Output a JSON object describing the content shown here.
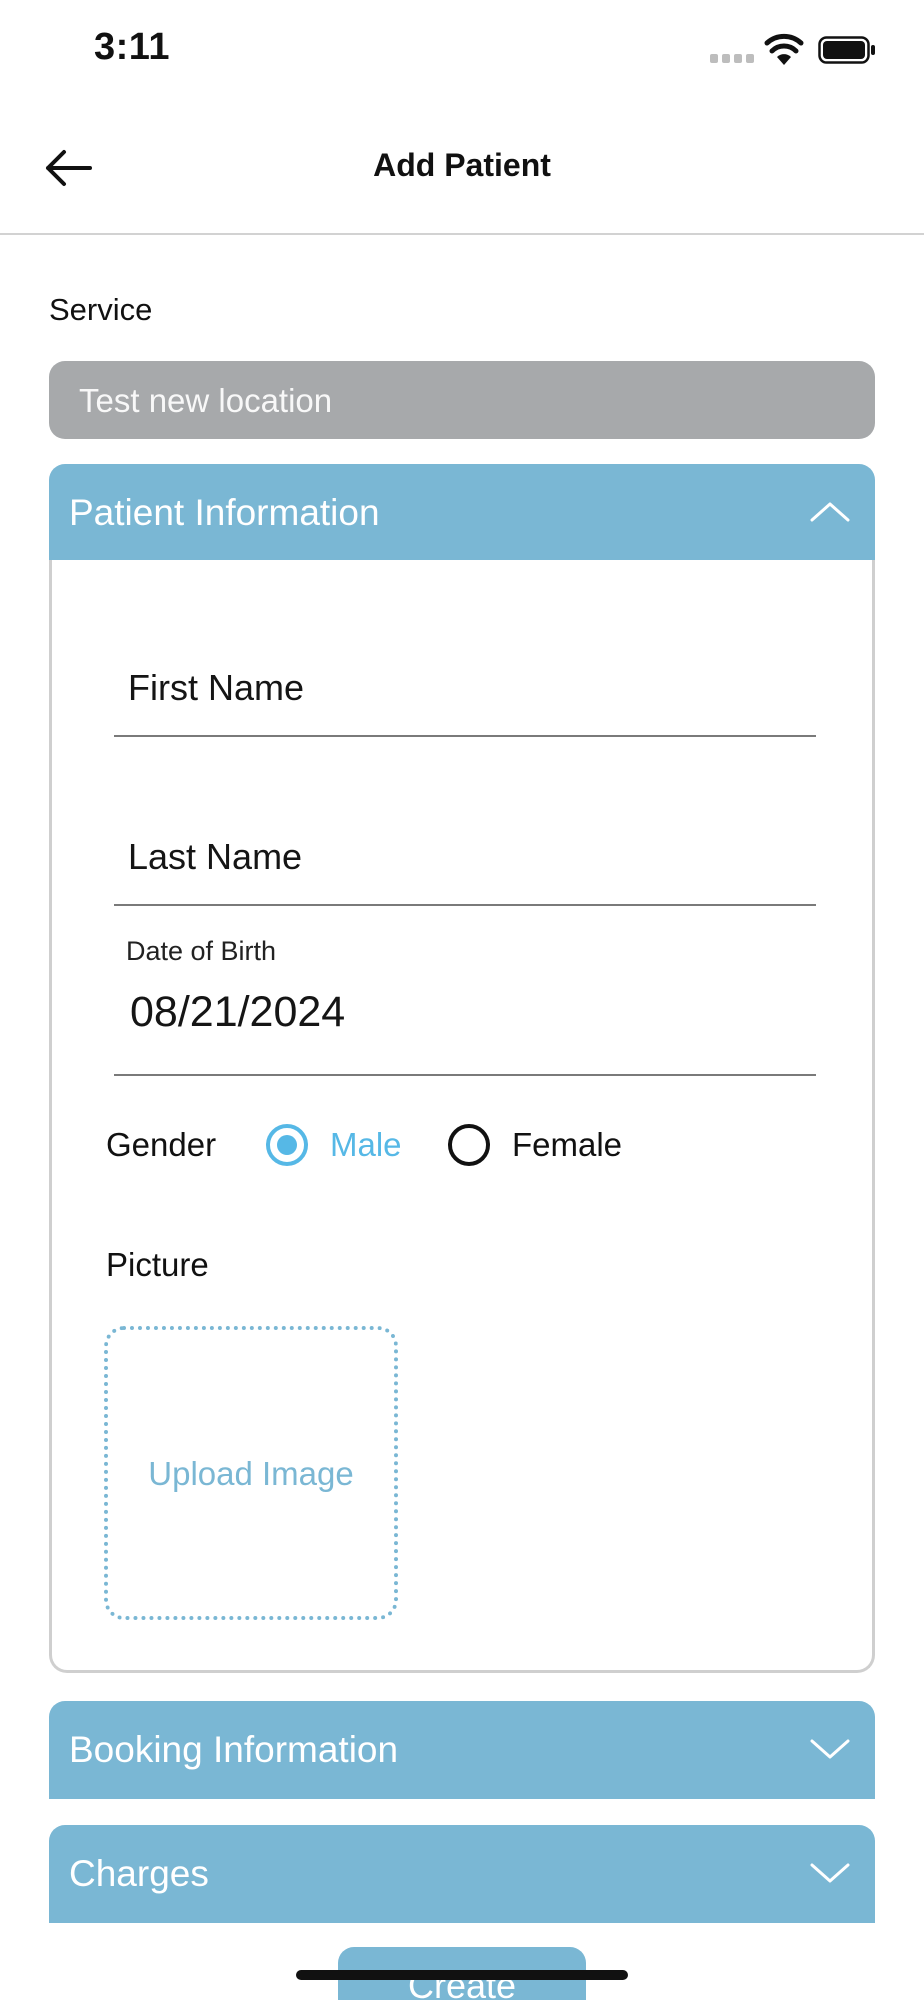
{
  "status_bar": {
    "time": "3:11",
    "signal_icon": "signal-icon",
    "wifi_icon": "wifi-icon",
    "battery_icon": "battery-icon"
  },
  "nav": {
    "title": "Add Patient",
    "back_icon": "arrow-left-icon"
  },
  "service": {
    "label": "Service",
    "value": "Test new location"
  },
  "patient_section": {
    "title": "Patient Information",
    "expanded": true,
    "first_name_placeholder": "First Name",
    "last_name_placeholder": "Last Name",
    "dob_label": "Date of Birth",
    "dob_value": "08/21/2024",
    "gender_label": "Gender",
    "gender_options": [
      {
        "label": "Male",
        "selected": true
      },
      {
        "label": "Female",
        "selected": false
      }
    ],
    "picture_label": "Picture",
    "upload_label": "Upload Image"
  },
  "booking_section": {
    "title": "Booking Information",
    "expanded": false
  },
  "charges_section": {
    "title": "Charges",
    "expanded": false
  },
  "create_button": {
    "label": "Create"
  },
  "colors": {
    "accent": "#7ab7d4",
    "radio_selected": "#56b8e6",
    "service_field": "#a7a9ab",
    "panel_border": "#cfcfcf"
  }
}
